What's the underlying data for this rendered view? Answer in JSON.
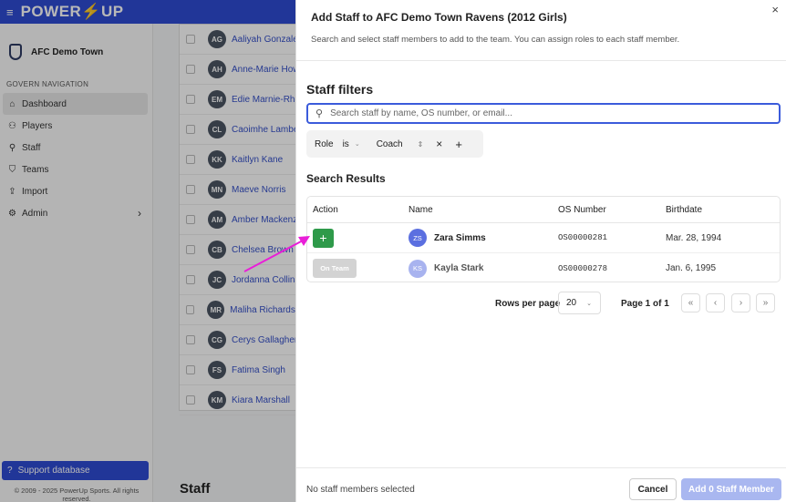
{
  "app": {
    "brand_left": "POWER",
    "brand_right": "UP",
    "menu_icon": "hamburger-icon"
  },
  "sidebar": {
    "org_name": "AFC Demo Town",
    "nav_heading": "GOVERN NAVIGATION",
    "items": [
      {
        "label": "Dashboard",
        "icon": "home-icon"
      },
      {
        "label": "Players",
        "icon": "users-icon"
      },
      {
        "label": "Staff",
        "icon": "staff-icon"
      },
      {
        "label": "Teams",
        "icon": "shield-icon"
      },
      {
        "label": "Import",
        "icon": "upload-icon"
      },
      {
        "label": "Admin",
        "icon": "settings-icon"
      }
    ],
    "support_label": "Support database",
    "copyright": "© 2009 - 2025 PowerUp Sports. All rights reserved."
  },
  "roster": [
    {
      "initials": "AG",
      "name": "Aaliyah Gonzalez"
    },
    {
      "initials": "AH",
      "name": "Anne-Marie Howe"
    },
    {
      "initials": "EM",
      "name": "Edie Marnie-Rhett"
    },
    {
      "initials": "CL",
      "name": "Caoimhe Lambert"
    },
    {
      "initials": "KK",
      "name": "Kaitlyn Kane"
    },
    {
      "initials": "MN",
      "name": "Maeve Norris"
    },
    {
      "initials": "AM",
      "name": "Amber Mackenzie"
    },
    {
      "initials": "CB",
      "name": "Chelsea Brown"
    },
    {
      "initials": "JC",
      "name": "Jordanna Collins"
    },
    {
      "initials": "MR",
      "name": "Maliha Richardson"
    },
    {
      "initials": "CG",
      "name": "Cerys Gallagher"
    },
    {
      "initials": "FS",
      "name": "Fatima Singh"
    },
    {
      "initials": "KM",
      "name": "Kiara Marshall"
    }
  ],
  "staff_heading": "Staff",
  "panel": {
    "title": "Add Staff to AFC Demo Town Ravens (2012 Girls)",
    "subtitle": "Search and select staff members to add to the team. You can assign roles to each staff member.",
    "filters_title": "Staff filters",
    "search_placeholder": "Search staff by name, OS number, or email...",
    "filter": {
      "field": "Role",
      "operator": "is",
      "value": "Coach",
      "remove": "×",
      "add": "+"
    },
    "results_title": "Search Results",
    "columns": [
      "Action",
      "Name",
      "OS Number",
      "Birthdate"
    ],
    "rows": [
      {
        "action": "+",
        "initials": "ZS",
        "name": "Zara Simms",
        "os_number": "OS00000281",
        "birthdate": "Mar. 28, 1994"
      },
      {
        "action": "On Team",
        "initials": "KS",
        "name": "Kayla Stark",
        "os_number": "OS00000278",
        "birthdate": "Jan. 6, 1995"
      }
    ],
    "pagination": {
      "rows_per_page_label": "Rows per page",
      "rows_per_page": "20",
      "page_label": "Page 1 of 1",
      "first": "«",
      "prev": "‹",
      "next": "›",
      "last": "»"
    },
    "footer_status": "No staff members selected",
    "cancel_label": "Cancel",
    "submit_label": "Add 0 Staff Member",
    "close": "×"
  },
  "colors": {
    "brand_blue": "#2f4bd3",
    "accent_yellow": "#f6c323",
    "add_green": "#2e9a4a",
    "arrow_magenta": "#e91ed8"
  }
}
